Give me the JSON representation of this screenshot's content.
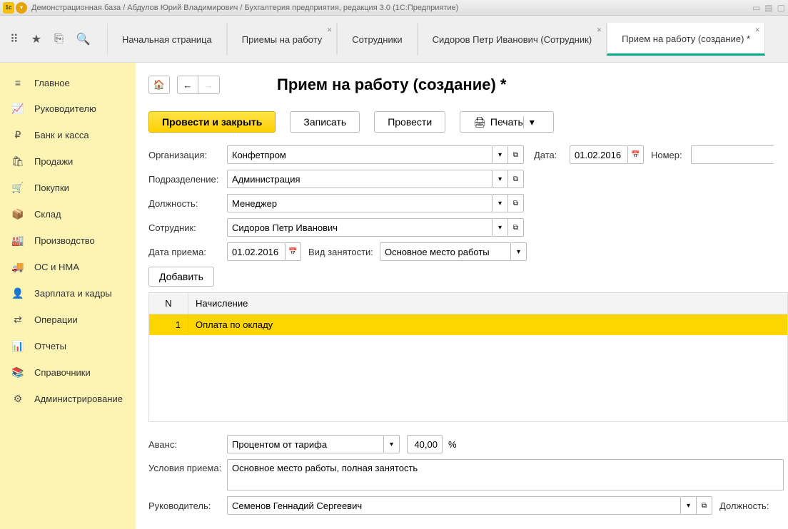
{
  "titlebar": {
    "text": "Демонстрационная база / Абдулов Юрий Владимирович / Бухгалтерия предприятия, редакция 3.0  (1С:Предприятие)"
  },
  "tabs": {
    "home": "Начальная страница",
    "t1": "Приемы на работу",
    "t2": "Сотрудники",
    "t3": "Сидоров Петр Иванович (Сотрудник)",
    "t4": "Прием на работу (создание) *"
  },
  "sidebar": [
    {
      "icon": "≡",
      "label": "Главное"
    },
    {
      "icon": "📈",
      "label": "Руководителю"
    },
    {
      "icon": "₽",
      "label": "Банк и касса"
    },
    {
      "icon": "🛍",
      "label": "Продажи"
    },
    {
      "icon": "🛒",
      "label": "Покупки"
    },
    {
      "icon": "📦",
      "label": "Склад"
    },
    {
      "icon": "🏭",
      "label": "Производство"
    },
    {
      "icon": "🚚",
      "label": "ОС и НМА"
    },
    {
      "icon": "👤",
      "label": "Зарплата и кадры"
    },
    {
      "icon": "⇄",
      "label": "Операции"
    },
    {
      "icon": "📊",
      "label": "Отчеты"
    },
    {
      "icon": "📚",
      "label": "Справочники"
    },
    {
      "icon": "⚙",
      "label": "Администрирование"
    }
  ],
  "page": {
    "title": "Прием на работу (создание) *"
  },
  "actions": {
    "post_close": "Провести и закрыть",
    "write": "Записать",
    "post": "Провести",
    "print": "Печать"
  },
  "form": {
    "org_label": "Организация:",
    "org_value": "Конфетпром",
    "date_label": "Дата:",
    "date_value": "01.02.2016",
    "number_label": "Номер:",
    "number_value": "",
    "dept_label": "Подразделение:",
    "dept_value": "Администрация",
    "pos_label": "Должность:",
    "pos_value": "Менеджер",
    "emp_label": "Сотрудник:",
    "emp_value": "Сидоров Петр Иванович",
    "hire_date_label": "Дата приема:",
    "hire_date_value": "01.02.2016",
    "emp_type_label": "Вид занятости:",
    "emp_type_value": "Основное место работы",
    "add_btn": "Добавить"
  },
  "table": {
    "col_n": "N",
    "col_desc": "Начисление",
    "rows": [
      {
        "n": "1",
        "desc": "Оплата по окладу"
      }
    ]
  },
  "lower": {
    "advance_label": "Аванс:",
    "advance_type": "Процентом от тарифа",
    "advance_value": "40,00",
    "advance_unit": "%",
    "conditions_label": "Условия приема:",
    "conditions_value": "Основное место работы, полная занятость",
    "manager_label": "Руководитель:",
    "manager_value": "Семенов Геннадий Сергеевич",
    "manager_pos_label": "Должность:"
  }
}
